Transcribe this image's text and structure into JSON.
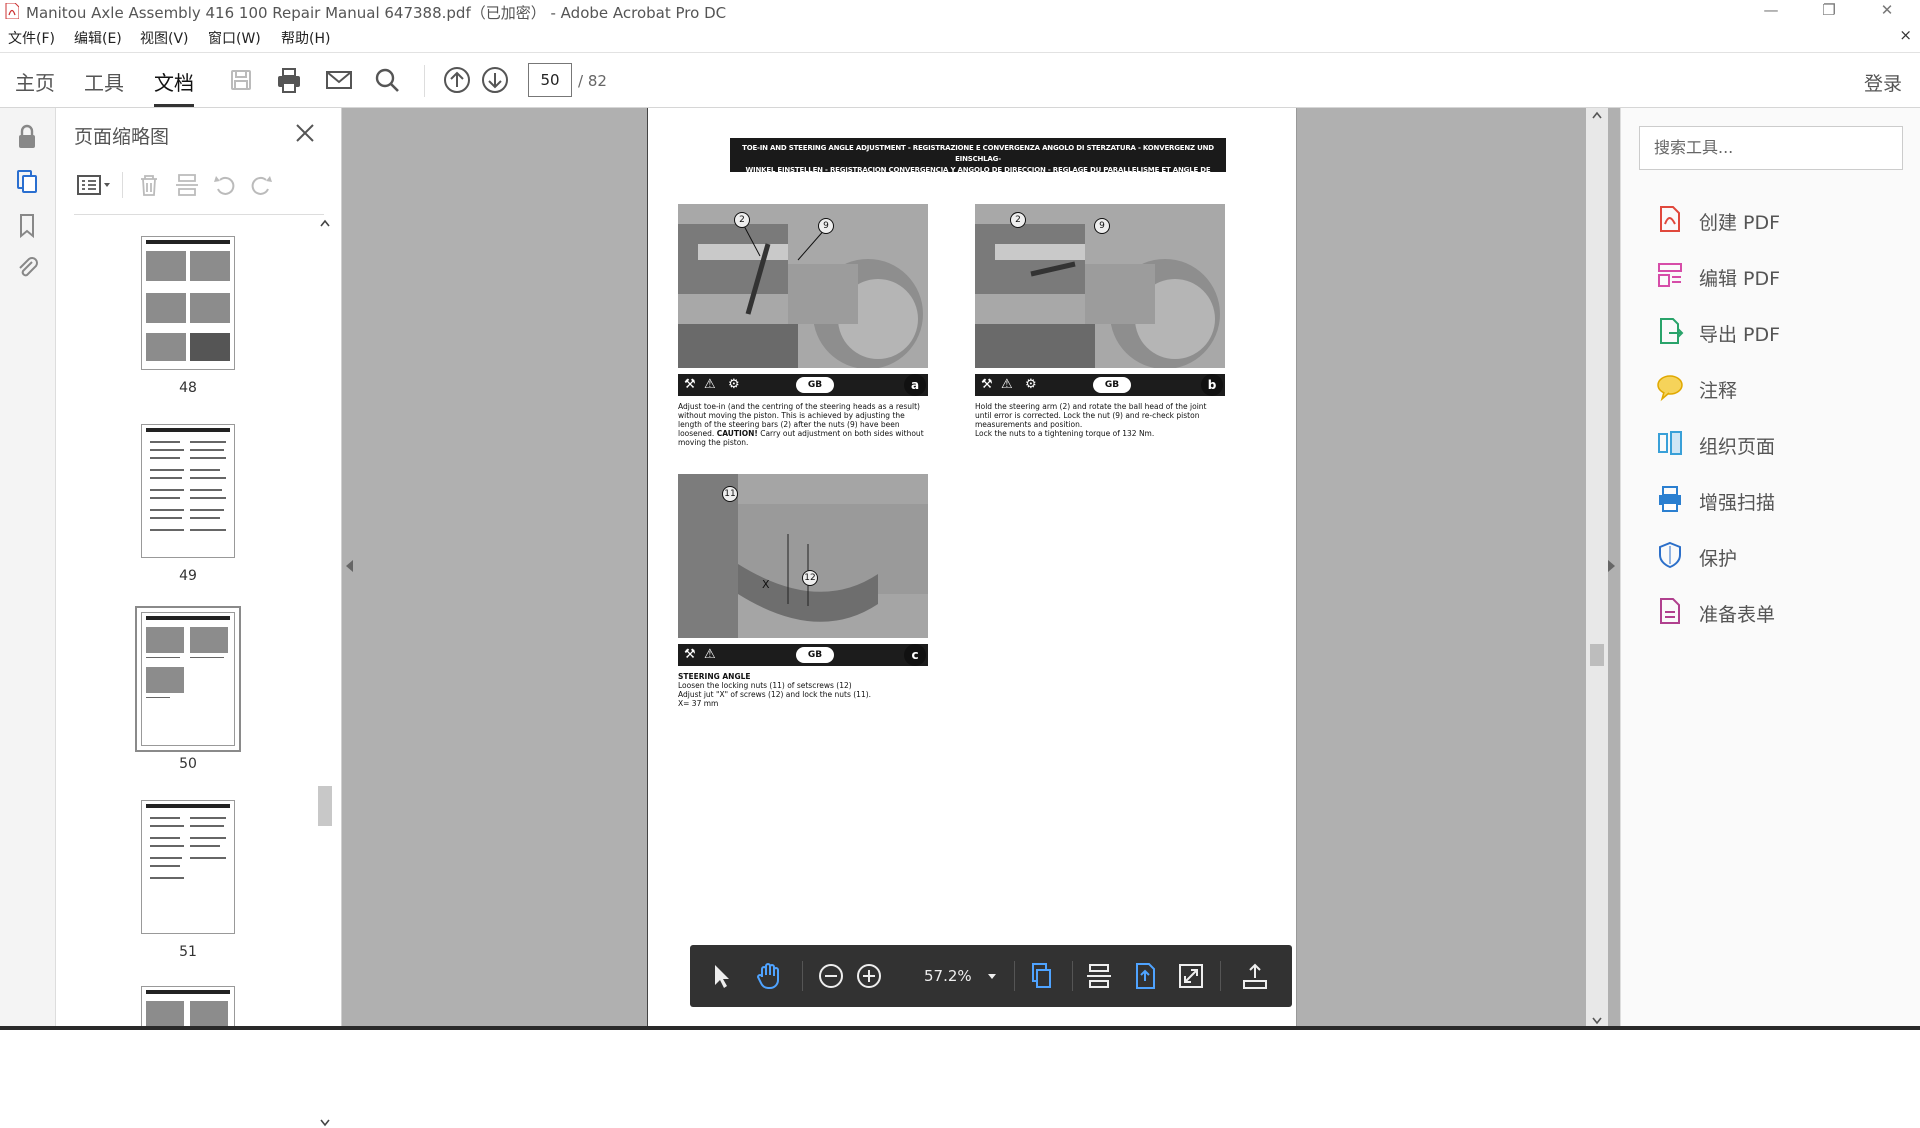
{
  "window": {
    "title": "Manitou Axle Assembly 416 100 Repair Manual 647388.pdf（已加密） - Adobe Acrobat Pro DC",
    "minimize": "—",
    "restore": "❐",
    "close": "✕"
  },
  "menubar": {
    "items": [
      "文件(F)",
      "编辑(E)",
      "视图(V)",
      "窗口(W)",
      "帮助(H)"
    ],
    "doc_close": "×"
  },
  "toolbar": {
    "tabs": [
      "主页",
      "工具",
      "文档"
    ],
    "active_tab": "文档",
    "page_current": "50",
    "page_total": "/ 82",
    "login": "登录"
  },
  "thumbnail_panel": {
    "title": "页面缩略图",
    "thumbnails": [
      {
        "label": "48",
        "selected": false
      },
      {
        "label": "49",
        "selected": false
      },
      {
        "label": "50",
        "selected": true
      },
      {
        "label": "51",
        "selected": false
      }
    ]
  },
  "document": {
    "banner_line1": "TOE-IN AND STEERING ANGLE ADJUSTMENT - REGISTRAZIONE E CONVERGENZA ANGOLO DI STERZATURA - KONVERGENZ UND EINSCHLAG-",
    "banner_line2": "WINKEL EINSTELLEN - REGISTRACION CONVERGENCIA Y ANGOLO DE DIRECCION - REGLAGE DU PARALLELISME ET ANGLE DE BRAQUAGE",
    "figures": [
      {
        "letter": "a",
        "lang": "GB",
        "callouts": [
          "2",
          "9"
        ],
        "text": "Adjust toe-in (and the centring of the steering heads as a result) without moving the piston. This is achieved by adjusting the length of the steering bars (2) after the nuts (9) have been loosened.",
        "caution_label": "CAUTION!",
        "caution_text": " Carry out adjustment on both sides without moving the piston."
      },
      {
        "letter": "b",
        "lang": "GB",
        "callouts": [
          "2",
          "9"
        ],
        "text": "Hold the steering arm (2) and rotate the ball head of the joint until error is corrected. Lock the nut (9) and re-check piston measurements and position.",
        "text2": "Lock the nuts to a tightening torque of 132 Nm."
      },
      {
        "letter": "c",
        "lang": "GB",
        "callouts": [
          "11",
          "12"
        ],
        "x_label": "X",
        "heading": "STEERING ANGLE",
        "text": "Loosen the locking nuts (11) of setscrews (12)",
        "text2": "Adjust jut \"X\" of screws (12) and lock the nuts (11).",
        "text3": "X= 37 mm"
      }
    ]
  },
  "floating_toolbar": {
    "zoom": "57.2%"
  },
  "right_panel": {
    "search_placeholder": "搜索工具...",
    "tools": [
      {
        "label": "创建 PDF",
        "color": "#e0483c"
      },
      {
        "label": "编辑 PDF",
        "color": "#d64ca8"
      },
      {
        "label": "导出 PDF",
        "color": "#29a36a"
      },
      {
        "label": "注释",
        "color": "#f0b400"
      },
      {
        "label": "组织页面",
        "color": "#39a0d8"
      },
      {
        "label": "增强扫描",
        "color": "#2a7fd0"
      },
      {
        "label": "保护",
        "color": "#2c6fc9"
      },
      {
        "label": "准备表单",
        "color": "#b0408e"
      }
    ]
  },
  "icons": {
    "save": "save-icon",
    "print": "print-icon",
    "mail": "mail-icon",
    "search": "search-icon",
    "prev": "arrow-up-circle-icon",
    "next": "arrow-down-circle-icon"
  }
}
